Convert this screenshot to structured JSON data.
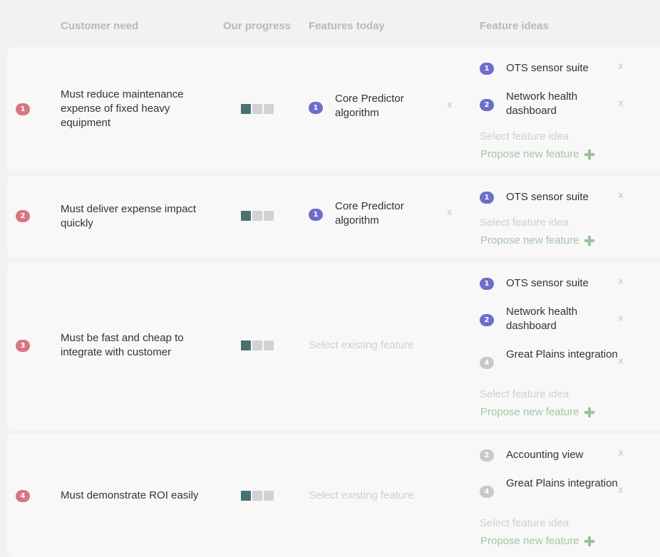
{
  "headers": {
    "customer_need": "Customer need",
    "our_progress": "Our progress",
    "features_today": "Features today",
    "feature_ideas": "Feature ideas"
  },
  "colors": {
    "need_badge": "#d77581",
    "feature_badge": "#6d6dcc",
    "inactive_badge": "#c9c9c9",
    "progress_done": "#4a7070",
    "progress_todo": "#d2d2d2",
    "propose": "#a7c4a7"
  },
  "labels": {
    "select_feature_idea": "Select feature idea",
    "select_existing_feature": "Select existing feature",
    "propose_new_feature": "Propose new feature",
    "remove": "x"
  },
  "rows": [
    {
      "num": "1",
      "need": "Must reduce maintenance expense of fixed heavy equipment",
      "progress": {
        "done": 1,
        "total": 3
      },
      "features_today": [
        {
          "num": "1",
          "name": "Core Predictor algorithm"
        }
      ],
      "feature_ideas": [
        {
          "num": "1",
          "name": "OTS sensor suite"
        },
        {
          "num": "2",
          "name": "Network health dashboard"
        }
      ]
    },
    {
      "num": "2",
      "need": "Must deliver expense impact quickly",
      "progress": {
        "done": 1,
        "total": 3
      },
      "features_today": [
        {
          "num": "1",
          "name": "Core Predictor algorithm"
        }
      ],
      "feature_ideas": [
        {
          "num": "1",
          "name": "OTS sensor suite"
        }
      ]
    },
    {
      "num": "3",
      "need": "Must be fast and cheap to integrate with customer",
      "progress": {
        "done": 1,
        "total": 3
      },
      "features_today": [],
      "feature_ideas": [
        {
          "num": "1",
          "name": "OTS sensor suite"
        },
        {
          "num": "2",
          "name": "Network health dashboard"
        },
        {
          "num": "4",
          "name": "Great Plains integration"
        }
      ]
    },
    {
      "num": "4",
      "need": "Must demonstrate ROI easily",
      "progress": {
        "done": 1,
        "total": 3
      },
      "features_today": [],
      "feature_ideas": [
        {
          "num": "2",
          "name": "Accounting view"
        },
        {
          "num": "4",
          "name": "Great Plains integration"
        }
      ]
    }
  ]
}
